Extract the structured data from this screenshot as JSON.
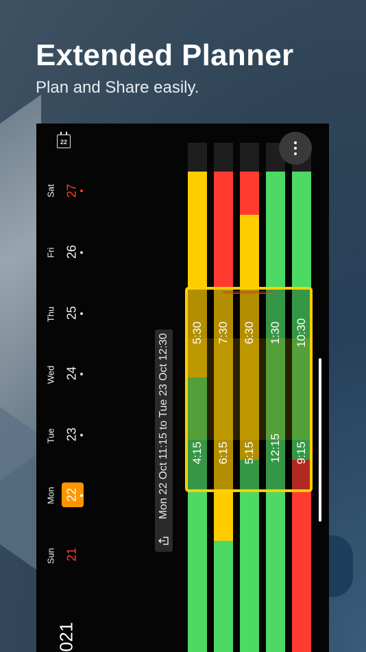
{
  "header": {
    "title": "Extended Planner",
    "subtitle": "Plan and Share easily."
  },
  "calendar_icon_day": "22",
  "days": [
    {
      "name": "Sat",
      "num": "27",
      "weekend": true,
      "today": false
    },
    {
      "name": "Fri",
      "num": "26",
      "weekend": false,
      "today": false
    },
    {
      "name": "Thu",
      "num": "25",
      "weekend": false,
      "today": false
    },
    {
      "name": "Wed",
      "num": "24",
      "weekend": false,
      "today": false
    },
    {
      "name": "Tue",
      "num": "23",
      "weekend": false,
      "today": false
    },
    {
      "name": "Mon",
      "num": "22",
      "weekend": false,
      "today": true
    },
    {
      "name": "Sun",
      "num": "21",
      "weekend": true,
      "today": false
    }
  ],
  "year_label": "021",
  "share_range": "Mon 22 Oct 11:15 to Tue 23 Oct 12:30",
  "timezones": [
    {
      "time_start": "5:30",
      "time_end": "4:15"
    },
    {
      "time_start": "7:30",
      "time_end": "6:15"
    },
    {
      "time_start": "6:30",
      "time_end": "5:15"
    },
    {
      "time_start": "1:30",
      "time_end": "12:15"
    },
    {
      "time_start": "10:30",
      "time_end": "9:15"
    }
  ],
  "colors": {
    "green": "#4cd964",
    "yellow": "#ffcc00",
    "red": "#ff3b30",
    "orange": "#ff9500",
    "selection": "#ffd000"
  }
}
